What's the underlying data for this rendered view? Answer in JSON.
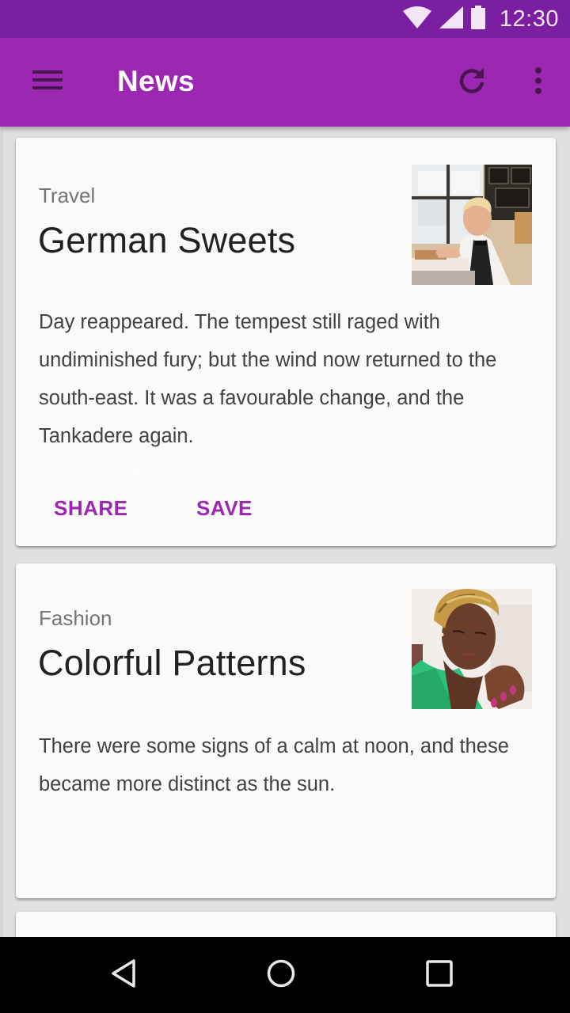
{
  "status_bar": {
    "time": "12:30",
    "icons": [
      "wifi-icon",
      "cell-signal-icon",
      "battery-icon"
    ],
    "color": "#7b1fa2"
  },
  "app_bar": {
    "title": "News",
    "color": "#9c27b0",
    "icons": [
      "menu-icon",
      "refresh-icon",
      "overflow-menu-icon"
    ]
  },
  "cards": [
    {
      "category": "Travel",
      "title": "German Sweets",
      "image": "photo of smiling waiter in bow tie and apron arranging pastries at a cafe counter",
      "body": "Day reappeared. The tempest still raged with undiminished fury; but the wind now returned to the south-east. It was a favourable change, and the Tankadere again.",
      "artifact": "∞",
      "actions": [
        {
          "label": "SHARE"
        },
        {
          "label": "SAVE"
        }
      ]
    },
    {
      "category": "Fashion",
      "title": "Colorful Patterns",
      "image": "photo of woman in patterned headwrap and green shirt with clasped hands",
      "body": "There were some signs of a calm at noon, and these became more distinct as the sun."
    }
  ],
  "accent_color": "#9c27b0",
  "nav_bar": {
    "buttons": [
      "back-icon",
      "home-icon",
      "recents-icon"
    ]
  }
}
